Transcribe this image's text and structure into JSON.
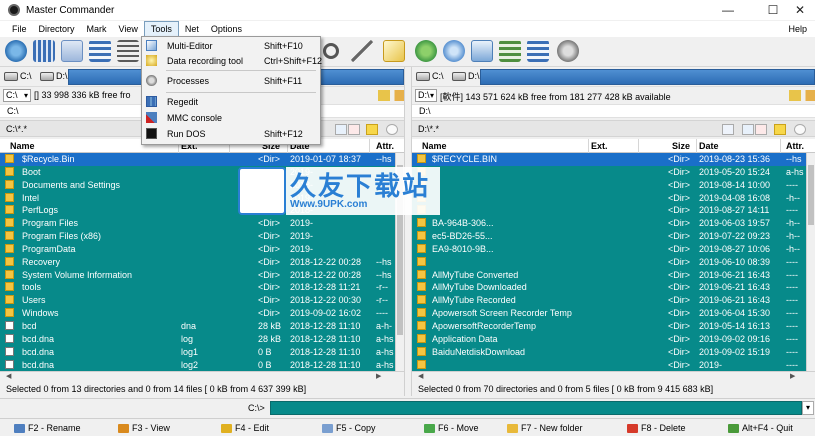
{
  "window": {
    "title": "Master Commander",
    "minimize": "—",
    "maximize": "☐",
    "close": "✕"
  },
  "menu": {
    "items": [
      "File",
      "Directory",
      "Mark",
      "View",
      "Tools",
      "Net",
      "Options"
    ],
    "active": "Tools",
    "help": "Help"
  },
  "tools_menu": {
    "items": [
      {
        "label": "Multi-Editor",
        "shortcut": "Shift+F10",
        "icon": "multi-editor-icon"
      },
      {
        "label": "Data recording tool",
        "shortcut": "Ctrl+Shift+F12",
        "icon": "recording-icon"
      },
      {
        "label": "Processes",
        "shortcut": "Shift+F11",
        "icon": "processes-icon"
      },
      {
        "label": "Regedit",
        "shortcut": "",
        "icon": "regedit-icon"
      },
      {
        "label": "MMC console",
        "shortcut": "",
        "icon": "mmc-icon"
      },
      {
        "label": "Run DOS",
        "shortcut": "Shift+F12",
        "icon": "dos-icon"
      }
    ]
  },
  "left": {
    "drives": [
      {
        "label": "C:\\"
      },
      {
        "label": "D:\\"
      }
    ],
    "drive_select": "C:\\",
    "info": "[] 33 998 336 kB free fro",
    "path": "C:\\",
    "filter": "C:\\*.*",
    "columns": {
      "name": "Name",
      "ext": "Ext.",
      "size": "Size",
      "date": "Date",
      "attr": "Attr."
    },
    "rows": [
      {
        "name": "$Recycle.Bin",
        "ext": "",
        "size": "<Dir>",
        "date": "2019-01-07 18:37",
        "attr": "--hs",
        "type": "folder",
        "selected": true
      },
      {
        "name": "Boot",
        "ext": "",
        "size": "<Dir>",
        "date": "2019-",
        "attr": "",
        "type": "folder"
      },
      {
        "name": "Documents and Settings",
        "ext": "",
        "size": "<Link>",
        "date": "2018-",
        "attr": "",
        "type": "folder"
      },
      {
        "name": "Intel",
        "ext": "",
        "size": "<Dir>",
        "date": "2019-",
        "attr": "",
        "type": "folder"
      },
      {
        "name": "PerfLogs",
        "ext": "",
        "size": "<Dir>",
        "date": "2018-",
        "attr": "",
        "type": "folder"
      },
      {
        "name": "Program Files",
        "ext": "",
        "size": "<Dir>",
        "date": "2019-",
        "attr": "",
        "type": "folder"
      },
      {
        "name": "Program Files (x86)",
        "ext": "",
        "size": "<Dir>",
        "date": "2019-",
        "attr": "",
        "type": "folder"
      },
      {
        "name": "ProgramData",
        "ext": "",
        "size": "<Dir>",
        "date": "2019-",
        "attr": "",
        "type": "folder"
      },
      {
        "name": "Recovery",
        "ext": "",
        "size": "<Dir>",
        "date": "2018-12-22 00:28",
        "attr": "--hs",
        "type": "folder"
      },
      {
        "name": "System Volume Information",
        "ext": "",
        "size": "<Dir>",
        "date": "2018-12-22 00:28",
        "attr": "--hs",
        "type": "folder"
      },
      {
        "name": "tools",
        "ext": "",
        "size": "<Dir>",
        "date": "2018-12-28 11:21",
        "attr": "-r--",
        "type": "folder"
      },
      {
        "name": "Users",
        "ext": "",
        "size": "<Dir>",
        "date": "2018-12-22 00:30",
        "attr": "-r--",
        "type": "folder"
      },
      {
        "name": "Windows",
        "ext": "",
        "size": "<Dir>",
        "date": "2019-09-02 16:02",
        "attr": "----",
        "type": "folder"
      },
      {
        "name": "bcd",
        "ext": "dna",
        "size": "28 kB",
        "date": "2018-12-28 11:10",
        "attr": "a-h-",
        "type": "file"
      },
      {
        "name": "bcd.dna",
        "ext": "log",
        "size": "28 kB",
        "date": "2018-12-28 11:10",
        "attr": "a-hs",
        "type": "file"
      },
      {
        "name": "bcd.dna",
        "ext": "log1",
        "size": "0 B",
        "date": "2018-12-28 11:10",
        "attr": "a-hs",
        "type": "file"
      },
      {
        "name": "bcd.dna",
        "ext": "log2",
        "size": "0 B",
        "date": "2018-12-28 11:10",
        "attr": "a-hs",
        "type": "file"
      }
    ],
    "status": "Selected 0 from 13 directories and 0 from 14 files [ 0 kB from 4 637 399 kB]"
  },
  "right": {
    "drives": [
      {
        "label": "C:\\"
      },
      {
        "label": "D:\\"
      }
    ],
    "drive_select": "D:\\",
    "info": "[軟件] 143 571 624 kB free from 181 277 428 kB available",
    "path": "D:\\",
    "filter": "D:\\*.*",
    "columns": {
      "name": "Name",
      "ext": "Ext.",
      "size": "Size",
      "date": "Date",
      "attr": "Attr."
    },
    "rows": [
      {
        "name": "$RECYCLE.BIN",
        "ext": "",
        "size": "<Dir>",
        "date": "2019-08-23 15:36",
        "attr": "--hs",
        "type": "folder",
        "selected": true
      },
      {
        "name": "",
        "ext": "",
        "size": "<Dir>",
        "date": "2019-05-20 15:24",
        "attr": "a-hs",
        "type": "folder"
      },
      {
        "name": "",
        "ext": "",
        "size": "<Dir>",
        "date": "2019-08-14 10:00",
        "attr": "----",
        "type": "folder"
      },
      {
        "name": "",
        "ext": "",
        "size": "<Dir>",
        "date": "2019-04-08 16:08",
        "attr": "-h--",
        "type": "folder"
      },
      {
        "name": "",
        "ext": "",
        "size": "<Dir>",
        "date": "2019-08-27 14:11",
        "attr": "----",
        "type": "folder"
      },
      {
        "name": "BA-964B-306...",
        "ext": "",
        "size": "<Dir>",
        "date": "2019-06-03 19:57",
        "attr": "-h--",
        "type": "folder"
      },
      {
        "name": "ec5-BD26-55...",
        "ext": "",
        "size": "<Dir>",
        "date": "2019-07-22 09:23",
        "attr": "-h--",
        "type": "folder"
      },
      {
        "name": "EA9-8010-9B...",
        "ext": "",
        "size": "<Dir>",
        "date": "2019-08-27 10:06",
        "attr": "-h--",
        "type": "folder"
      },
      {
        "name": "",
        "ext": "",
        "size": "<Dir>",
        "date": "2019-06-10 08:39",
        "attr": "----",
        "type": "folder"
      },
      {
        "name": "AllMyTube Converted",
        "ext": "",
        "size": "<Dir>",
        "date": "2019-06-21 16:43",
        "attr": "----",
        "type": "folder"
      },
      {
        "name": "AllMyTube Downloaded",
        "ext": "",
        "size": "<Dir>",
        "date": "2019-06-21 16:43",
        "attr": "----",
        "type": "folder"
      },
      {
        "name": "AllMyTube Recorded",
        "ext": "",
        "size": "<Dir>",
        "date": "2019-06-21 16:43",
        "attr": "----",
        "type": "folder"
      },
      {
        "name": "Apowersoft Screen Recorder Temp",
        "ext": "",
        "size": "<Dir>",
        "date": "2019-06-04 15:30",
        "attr": "----",
        "type": "folder"
      },
      {
        "name": "ApowersoftRecorderTemp",
        "ext": "",
        "size": "<Dir>",
        "date": "2019-05-14 16:13",
        "attr": "----",
        "type": "folder"
      },
      {
        "name": "Application Data",
        "ext": "",
        "size": "<Dir>",
        "date": "2019-09-02 09:16",
        "attr": "----",
        "type": "folder"
      },
      {
        "name": "BaiduNetdiskDownload",
        "ext": "",
        "size": "<Dir>",
        "date": "2019-09-02 15:19",
        "attr": "----",
        "type": "folder"
      },
      {
        "name": "",
        "ext": "",
        "size": "<Dir>",
        "date": "2019-",
        "attr": "----",
        "type": "folder"
      }
    ],
    "status": "Selected 0 from 70 directories and 0 from 5 files [ 0 kB from 9 415 683 kB]"
  },
  "command": {
    "prompt": "C:\\>",
    "value": ""
  },
  "fkeys": [
    {
      "label": "F2 - Rename",
      "color": "#4f7fbf"
    },
    {
      "label": "F3 - View",
      "color": "#d98a1e"
    },
    {
      "label": "F4 - Edit",
      "color": "#e0b020"
    },
    {
      "label": "F5 - Copy",
      "color": "#7a9fd0"
    },
    {
      "label": "F6 - Move",
      "color": "#49a84a"
    },
    {
      "label": "F7 - New folder",
      "color": "#e8b93a"
    },
    {
      "label": "F8 - Delete",
      "color": "#d63a2a"
    },
    {
      "label": "Alt+F4 - Quit",
      "color": "#4a9a3a"
    }
  ],
  "watermark": {
    "text": "久友下载站",
    "url": "Www.9UPK.com"
  },
  "colors": {
    "panel_bg": "#078a8a",
    "selection": "#1a6fc9",
    "drive_bar": "#2d6cb4"
  }
}
